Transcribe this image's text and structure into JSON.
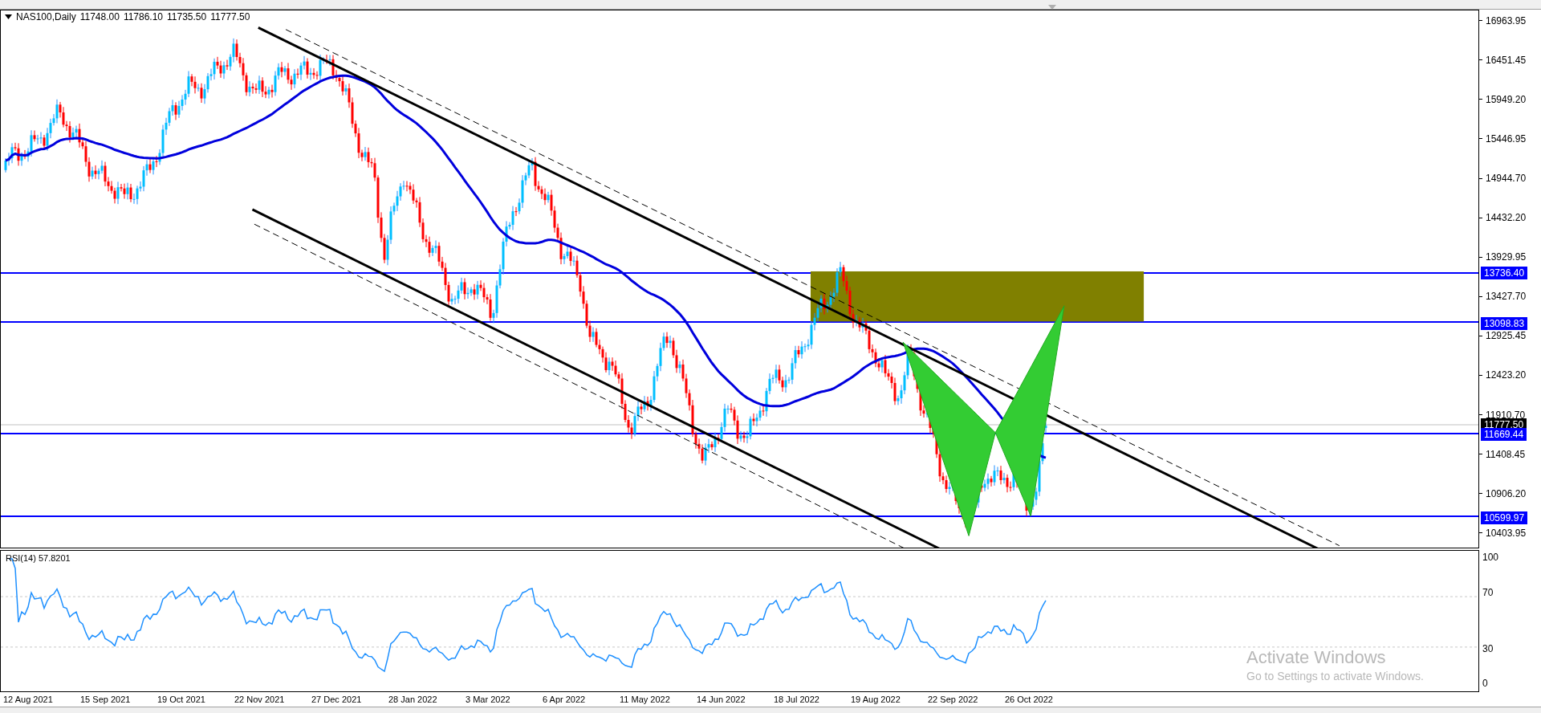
{
  "chart": {
    "symbol": "NAS100,Daily",
    "ohlc": [
      "11748.00",
      "11786.10",
      "11735.50",
      "11777.50"
    ],
    "price_ticks": [
      "16963.95",
      "16451.45",
      "15949.20",
      "15446.95",
      "14944.70",
      "14432.20",
      "13929.95",
      "13427.70",
      "12925.45",
      "12423.20",
      "11910.70",
      "11408.45",
      "10906.20",
      "10403.95"
    ],
    "price_markers": [
      {
        "label": "13736.40",
        "kind": "level"
      },
      {
        "label": "13098.83",
        "kind": "level"
      },
      {
        "label": "11777.50",
        "kind": "bid"
      },
      {
        "label": "11669.44",
        "kind": "level"
      },
      {
        "label": "10599.97",
        "kind": "level"
      }
    ]
  },
  "rsi": {
    "title": "RSI(14) 57.8201",
    "ticks": [
      "100",
      "70",
      "30",
      "0"
    ]
  },
  "time_axis": {
    "dates": [
      "12 Aug 2021",
      "15 Sep 2021",
      "19 Oct 2021",
      "22 Nov 2021",
      "27 Dec 2021",
      "28 Jan 2022",
      "3 Mar 2022",
      "6 Apr 2022",
      "11 May 2022",
      "14 Jun 2022",
      "18 Jul 2022",
      "19 Aug 2022",
      "22 Sep 2022",
      "26 Oct 2022"
    ]
  },
  "activation_notice": {
    "title": "Activate Windows",
    "text": "Go to Settings to activate Windows."
  }
}
